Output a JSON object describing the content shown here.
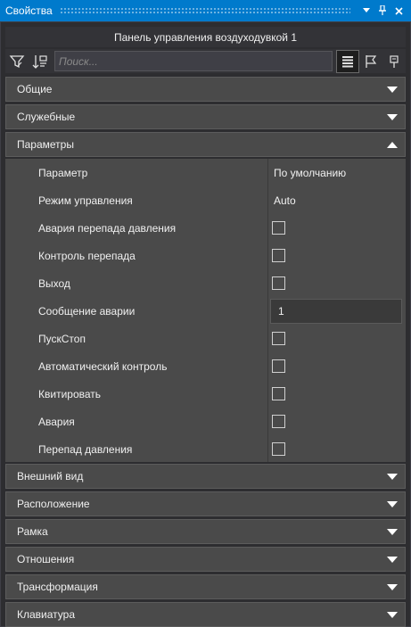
{
  "window": {
    "title": "Свойства"
  },
  "object_name": "Панель управления воздуходувкой 1",
  "search": {
    "placeholder": "Поиск..."
  },
  "sections_top": [
    {
      "label": "Общие",
      "expanded": false
    },
    {
      "label": "Служебные",
      "expanded": false
    },
    {
      "label": "Параметры",
      "expanded": true
    }
  ],
  "parameters": {
    "header_name": "Параметр",
    "header_value": "По умолчанию",
    "rows": [
      {
        "name": "Режим управления",
        "type": "text",
        "value": "Auto"
      },
      {
        "name": "Авария перепада давления",
        "type": "checkbox",
        "checked": false
      },
      {
        "name": "Контроль перепада",
        "type": "checkbox",
        "checked": false
      },
      {
        "name": "Выход",
        "type": "checkbox",
        "checked": false
      },
      {
        "name": "Сообщение аварии",
        "type": "input",
        "value": "1"
      },
      {
        "name": "ПускСтоп",
        "type": "checkbox",
        "checked": false
      },
      {
        "name": "Автоматический контроль",
        "type": "checkbox",
        "checked": false
      },
      {
        "name": "Квитировать",
        "type": "checkbox",
        "checked": false
      },
      {
        "name": "Авария",
        "type": "checkbox",
        "checked": false
      },
      {
        "name": "Перепад давления",
        "type": "checkbox",
        "checked": false
      }
    ]
  },
  "sections_bottom": [
    {
      "label": "Внешний вид",
      "expanded": false
    },
    {
      "label": "Расположение",
      "expanded": false
    },
    {
      "label": "Рамка",
      "expanded": false
    },
    {
      "label": "Отношения",
      "expanded": false
    },
    {
      "label": "Трансформация",
      "expanded": false
    },
    {
      "label": "Клавиатура",
      "expanded": false
    }
  ],
  "colors": {
    "titlebar": "#007acc",
    "panel": "#2d2d30",
    "section": "#4a4a4a"
  }
}
